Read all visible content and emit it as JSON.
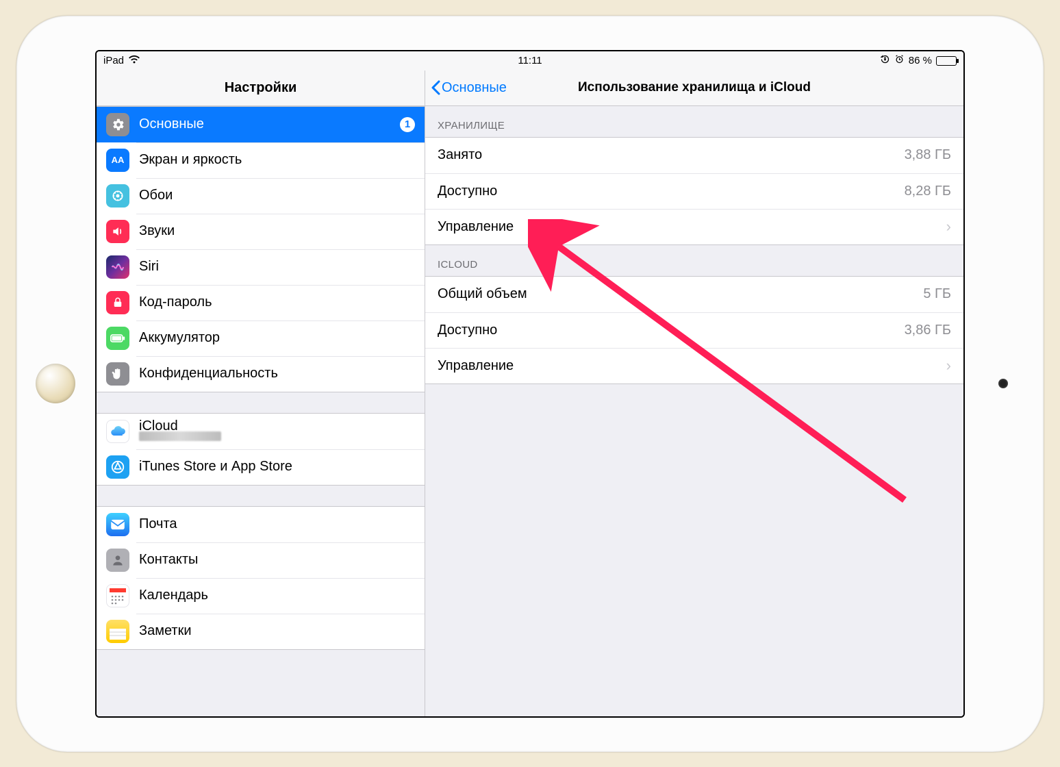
{
  "status": {
    "device": "iPad",
    "time": "11:11",
    "battery_pct": "86 %"
  },
  "left": {
    "title": "Настройки",
    "group0": [
      {
        "label": "Основные",
        "badge": "1",
        "active": true,
        "icon": "gear",
        "bg": "#8e8e93"
      },
      {
        "label": "Экран и яркость",
        "icon": "display",
        "bg": "#0a7aff"
      },
      {
        "label": "Обои",
        "icon": "wallpaper",
        "bg": "#45c1e0"
      },
      {
        "label": "Звуки",
        "icon": "speaker",
        "bg": "#ff2d55"
      },
      {
        "label": "Siri",
        "icon": "siri",
        "bg": "#000"
      },
      {
        "label": "Код-пароль",
        "icon": "lock",
        "bg": "#ff2d55"
      },
      {
        "label": "Аккумулятор",
        "icon": "battery",
        "bg": "#4cd964"
      },
      {
        "label": "Конфиденциальность",
        "icon": "hand",
        "bg": "#8e8e93"
      }
    ],
    "group1": [
      {
        "label": "iCloud",
        "icon": "cloud",
        "bg": "#fff"
      },
      {
        "label": "iTunes Store и App Store",
        "icon": "appstore",
        "bg": "#1da1f2"
      }
    ],
    "group2": [
      {
        "label": "Почта",
        "icon": "mail",
        "bg": "#1e90ff"
      },
      {
        "label": "Контакты",
        "icon": "contacts",
        "bg": "#b0b0b5"
      },
      {
        "label": "Календарь",
        "icon": "calendar",
        "bg": "#fff"
      },
      {
        "label": "Заметки",
        "icon": "notes",
        "bg": "#ffcc00"
      }
    ]
  },
  "right": {
    "back": "Основные",
    "title": "Использование хранилища и iCloud",
    "storage_header": "ХРАНИЛИЩЕ",
    "icloud_header": "ICLOUD",
    "storage": {
      "used_label": "Занято",
      "used_value": "3,88 ГБ",
      "avail_label": "Доступно",
      "avail_value": "8,28 ГБ",
      "manage_label": "Управление"
    },
    "icloud": {
      "total_label": "Общий объем",
      "total_value": "5 ГБ",
      "avail_label": "Доступно",
      "avail_value": "3,86 ГБ",
      "manage_label": "Управление"
    }
  },
  "colors": {
    "ios_blue": "#007aff",
    "select_blue": "#0a7aff",
    "arrow": "#ff1e56"
  }
}
